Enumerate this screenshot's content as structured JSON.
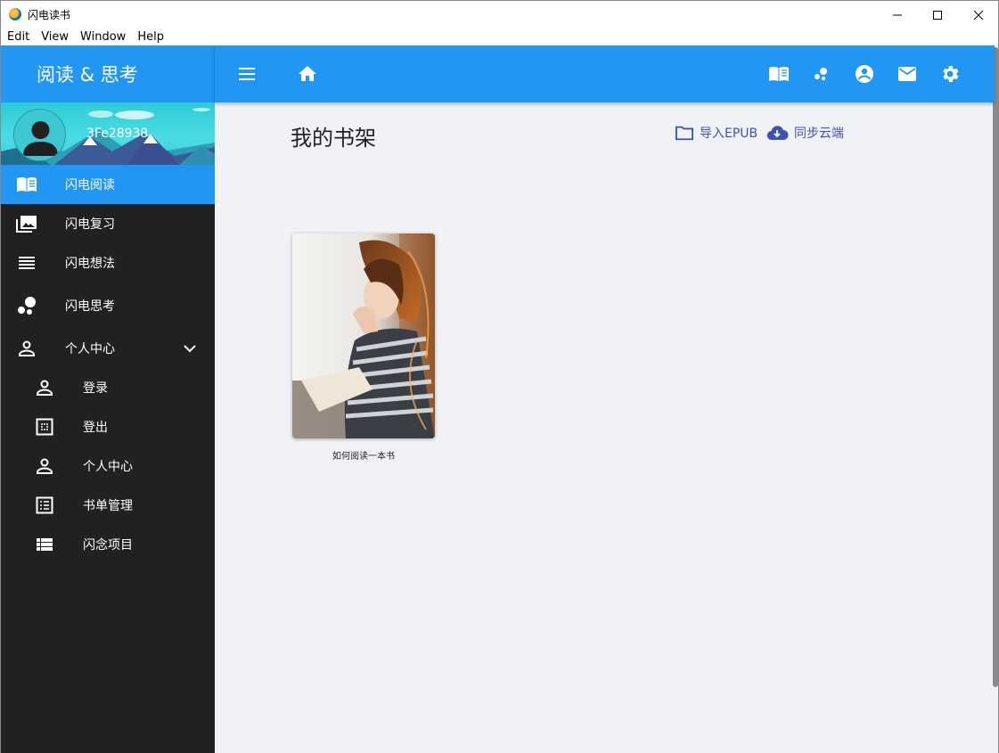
{
  "window": {
    "title": "闪电读书",
    "menu": [
      "Edit",
      "View",
      "Window",
      "Help"
    ]
  },
  "sidebar": {
    "brand": "阅读 & 思考",
    "username": "3Fe28938",
    "items": [
      {
        "label": "闪电阅读",
        "icon": "book-open-icon",
        "active": true
      },
      {
        "label": "闪电复习",
        "icon": "photo-library-icon"
      },
      {
        "label": "闪电想法",
        "icon": "lines-icon"
      },
      {
        "label": "闪电思考",
        "icon": "bubbles-icon"
      },
      {
        "label": "个人中心",
        "icon": "person-icon",
        "expanded": true
      },
      {
        "label": "登录",
        "icon": "person-icon",
        "sub": true
      },
      {
        "label": "登出",
        "icon": "dots-box-icon",
        "sub": true
      },
      {
        "label": "个人中心",
        "icon": "person-icon",
        "sub": true
      },
      {
        "label": "书单管理",
        "icon": "list-box-icon",
        "sub": true
      },
      {
        "label": "闪念项目",
        "icon": "view-list-icon",
        "sub": true
      }
    ]
  },
  "main": {
    "title": "我的书架",
    "import_label": "导入EPUB",
    "sync_label": "同步云端",
    "books": [
      {
        "title": "如何阅读一本书"
      }
    ]
  },
  "colors": {
    "primary": "#2196f3",
    "sidebar_bg": "#212121",
    "content_bg": "#f1f2f5",
    "action": "#3f51b5"
  }
}
